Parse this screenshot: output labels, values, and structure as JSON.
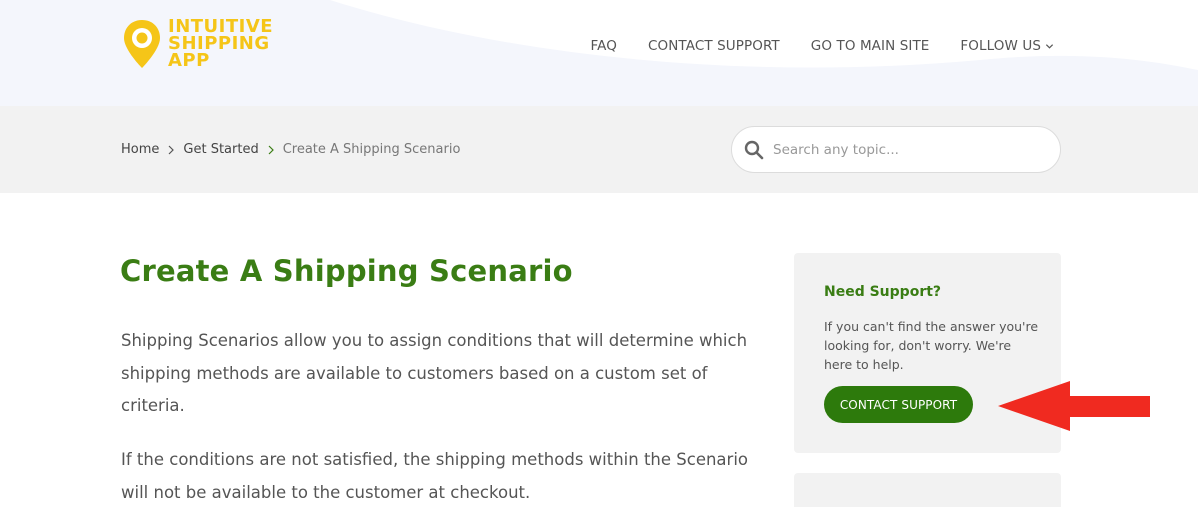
{
  "header": {
    "logo": {
      "lines": [
        "INTUITIVE",
        "SHIPPING",
        "APP"
      ],
      "icon": "location-pin-icon",
      "color": "#f5c518"
    },
    "nav": [
      {
        "label": "FAQ"
      },
      {
        "label": "CONTACT SUPPORT"
      },
      {
        "label": "GO TO MAIN SITE"
      },
      {
        "label": "FOLLOW US",
        "icon": "chevron-down-icon"
      }
    ]
  },
  "breadcrumb": {
    "items": [
      "Home",
      "Get Started"
    ],
    "current": "Create A Shipping Scenario"
  },
  "search": {
    "placeholder": "Search any topic...",
    "icon": "search-icon"
  },
  "article": {
    "title": "Create A Shipping Scenario",
    "paragraphs": [
      "Shipping Scenarios allow you to assign conditions that will determine which shipping methods are available to customers based on a custom set of criteria.",
      "If the conditions are not satisfied, the shipping methods within the Scenario will not be available to the customer at checkout."
    ]
  },
  "sidebar": {
    "support": {
      "title": "Need Support?",
      "text": "If you can't find the answer you're looking for, don't worry. We're here to help.",
      "button_label": "CONTACT SUPPORT"
    }
  },
  "colors": {
    "accent_green": "#3a7d14",
    "button_green": "#2d7a0c",
    "logo_yellow": "#f5c518",
    "arrow_red": "#f02a20"
  }
}
